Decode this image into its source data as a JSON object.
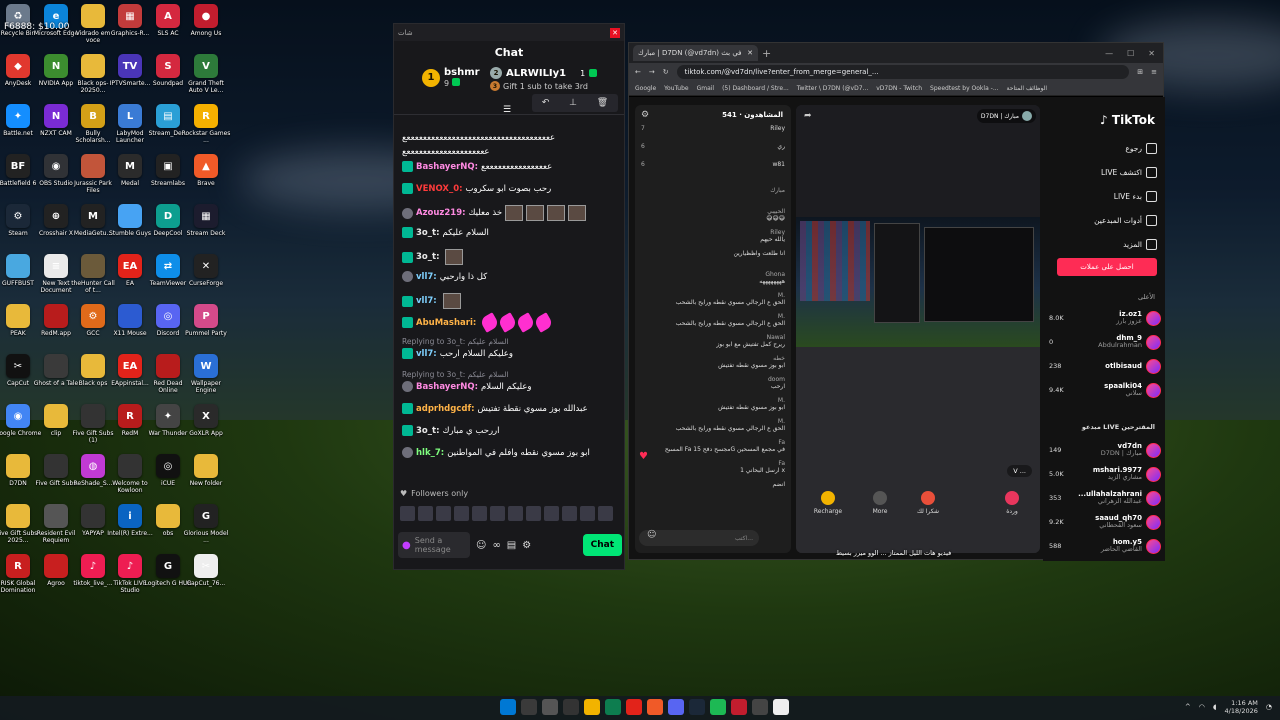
{
  "overlay": {
    "fps": "F6888: $10.00"
  },
  "desktop_icons": [
    {
      "label": "Recycle Bin",
      "color": "#6b7a8c",
      "glyph": "♻"
    },
    {
      "label": "Microsoft Edge",
      "color": "#0b84d9",
      "glyph": "e"
    },
    {
      "label": "Vidrado em voce",
      "color": "#e8b93a",
      "glyph": ""
    },
    {
      "label": "Graphics-R...",
      "color": "#c23b3b",
      "glyph": "▦"
    },
    {
      "label": "SLS AC",
      "color": "#d4283f",
      "glyph": "A"
    },
    {
      "label": "Among Us",
      "color": "#c21d2e",
      "glyph": "●"
    },
    {
      "label": "AnyDesk",
      "color": "#e1382e",
      "glyph": "◆"
    },
    {
      "label": "NVIDIA App",
      "color": "#3c8d2f",
      "glyph": "N"
    },
    {
      "label": "Black ops-20250...",
      "color": "#e8b93a",
      "glyph": ""
    },
    {
      "label": "IPTVSmarte...",
      "color": "#4a35b8",
      "glyph": "TV"
    },
    {
      "label": "Soundpad",
      "color": "#d4283f",
      "glyph": "S"
    },
    {
      "label": "Grand Theft Auto V Le...",
      "color": "#2d7a3a",
      "glyph": "V"
    },
    {
      "label": "Battle.net",
      "color": "#148eff",
      "glyph": "✦"
    },
    {
      "label": "NZXT CAM",
      "color": "#7a2bd4",
      "glyph": "N"
    },
    {
      "label": "Bully Scholarsh...",
      "color": "#d4a017",
      "glyph": "B"
    },
    {
      "label": "LabyMod Launcher",
      "color": "#3a7bd5",
      "glyph": "L"
    },
    {
      "label": "Stream_De...",
      "color": "#2a9fd6",
      "glyph": "▤"
    },
    {
      "label": "Rockstar Games ...",
      "color": "#f5b000",
      "glyph": "R"
    },
    {
      "label": "Battlefield 6",
      "color": "#222",
      "glyph": "BF"
    },
    {
      "label": "OBS Studio",
      "color": "#303236",
      "glyph": "◉"
    },
    {
      "label": "Jurassic Park Files",
      "color": "#c2553a",
      "glyph": ""
    },
    {
      "label": "Medal",
      "color": "#2b2b2b",
      "glyph": "M"
    },
    {
      "label": "Streamlabs",
      "color": "#222",
      "glyph": "▣"
    },
    {
      "label": "Brave",
      "color": "#f05a28",
      "glyph": "▲"
    },
    {
      "label": "Steam",
      "color": "#1b2838",
      "glyph": "⚙"
    },
    {
      "label": "Crosshair X",
      "color": "#222",
      "glyph": "⊕"
    },
    {
      "label": "MediaGetu...",
      "color": "#222",
      "glyph": "M"
    },
    {
      "label": "Stumble Guys",
      "color": "#47a3f3",
      "glyph": ""
    },
    {
      "label": "DeepCool",
      "color": "#0d9e8f",
      "glyph": "D"
    },
    {
      "label": "Stream Deck",
      "color": "#1c1c2e",
      "glyph": "▦"
    },
    {
      "label": "GUFFBUST",
      "color": "#49a8e0",
      "glyph": ""
    },
    {
      "label": "New Text Document",
      "color": "#eaeaea",
      "glyph": "≡"
    },
    {
      "label": "theHunter Call of t...",
      "color": "#6b5a3a",
      "glyph": ""
    },
    {
      "label": "EA",
      "color": "#e2231a",
      "glyph": "EA"
    },
    {
      "label": "TeamViewer",
      "color": "#0e8ee9",
      "glyph": "⇄"
    },
    {
      "label": "CurseForge",
      "color": "#222",
      "glyph": "✕"
    },
    {
      "label": "PEAK",
      "color": "#e8b93a",
      "glyph": ""
    },
    {
      "label": "RedM.app",
      "color": "#b81c1c",
      "glyph": ""
    },
    {
      "label": "GCC",
      "color": "#e06a1a",
      "glyph": "⚙"
    },
    {
      "label": "X11 Mouse",
      "color": "#2c5bd1",
      "glyph": ""
    },
    {
      "label": "Discord",
      "color": "#5865f2",
      "glyph": "◎"
    },
    {
      "label": "Pummel Party",
      "color": "#d44a8a",
      "glyph": "P"
    },
    {
      "label": "CapCut",
      "color": "#111",
      "glyph": "✂"
    },
    {
      "label": "Ghost of a Tale",
      "color": "#3a3a3a",
      "glyph": ""
    },
    {
      "label": "Black ops",
      "color": "#e8b93a",
      "glyph": ""
    },
    {
      "label": "EAppinstal...",
      "color": "#e2231a",
      "glyph": "EA"
    },
    {
      "label": "Red Dead Online",
      "color": "#b81c1c",
      "glyph": ""
    },
    {
      "label": "Wallpaper Engine",
      "color": "#2a6fd6",
      "glyph": "W"
    },
    {
      "label": "Google Chrome",
      "color": "#4285f4",
      "glyph": "◉"
    },
    {
      "label": "clip",
      "color": "#e8b93a",
      "glyph": ""
    },
    {
      "label": "Five Gift Subs (1)",
      "color": "#333",
      "glyph": ""
    },
    {
      "label": "RedM",
      "color": "#b81c1c",
      "glyph": "R"
    },
    {
      "label": "War Thunder",
      "color": "#444",
      "glyph": "✦"
    },
    {
      "label": "GoXLR App",
      "color": "#2a2a2a",
      "glyph": "X"
    },
    {
      "label": "D7DN",
      "color": "#e8b93a",
      "glyph": ""
    },
    {
      "label": "Five Gift Subs",
      "color": "#333",
      "glyph": ""
    },
    {
      "label": "ReShade_S...",
      "color": "#c03ad4",
      "glyph": "◍"
    },
    {
      "label": "Welcome to Kowloon",
      "color": "#333",
      "glyph": ""
    },
    {
      "label": "iCUE",
      "color": "#111",
      "glyph": "◎"
    },
    {
      "label": "New folder",
      "color": "#e8b93a",
      "glyph": ""
    },
    {
      "label": "Five Gift Subs-2025...",
      "color": "#e8b93a",
      "glyph": ""
    },
    {
      "label": "Resident Evil Requiem",
      "color": "#555",
      "glyph": ""
    },
    {
      "label": "YAPYAP",
      "color": "#333",
      "glyph": ""
    },
    {
      "label": "Intel(R) Extre...",
      "color": "#0a64c2",
      "glyph": "i"
    },
    {
      "label": "obs",
      "color": "#e8b93a",
      "glyph": ""
    },
    {
      "label": "Glorious Model ...",
      "color": "#222",
      "glyph": "G"
    },
    {
      "label": "RISK Global Domination",
      "color": "#c81f1f",
      "glyph": "R"
    },
    {
      "label": "Agroo",
      "color": "#c81f1f",
      "glyph": ""
    },
    {
      "label": "tiktok_live_...",
      "color": "#ee1d52",
      "glyph": "♪"
    },
    {
      "label": "TikTok LIVE Studio",
      "color": "#ee1d52",
      "glyph": "♪"
    },
    {
      "label": "Logitech G HUB",
      "color": "#111",
      "glyph": "G"
    },
    {
      "label": "CapCut_76...",
      "color": "#eee",
      "glyph": "✂"
    }
  ],
  "chat_window": {
    "bar_title": "شات",
    "title": "Chat",
    "leaders": [
      {
        "rank": "1",
        "name": "bshmr",
        "sub": "9"
      },
      {
        "name": "ALRWILIy1",
        "count": "1",
        "note": "Gift 1 sub to take 3rd"
      }
    ],
    "messages": [
      {
        "kind": "plain",
        "text": "ععععععععععععععععععععععععععععععععععععع"
      },
      {
        "kind": "plain",
        "text": "ععععععععععععععععععععع"
      },
      {
        "kind": "msg",
        "user": "BashayerNQ:",
        "text": "ععععععععععععععععع",
        "color": "#ff8ae2"
      },
      {
        "kind": "msg",
        "user": "VENOX_0:",
        "text": "رحب بصوت ابو سكروب",
        "color": "#ff3b3b"
      },
      {
        "kind": "msg",
        "user": "Azouz219:",
        "text": "خذ معليك",
        "color": "#ff8ae2"
      },
      {
        "kind": "msg",
        "user": "3o_t:",
        "text": "السلام عليكم",
        "color": "#e9e9e9"
      },
      {
        "kind": "msg",
        "user": "3o_t:",
        "text": "",
        "color": "#e9e9e9"
      },
      {
        "kind": "msg",
        "user": "vll7:",
        "text": "كل ذا وارحبي",
        "color": "#7fd1ff"
      },
      {
        "kind": "msg",
        "user": "vll7:",
        "text": "",
        "color": "#7fd1ff"
      },
      {
        "kind": "msg",
        "user": "AbuMashari:",
        "text": "",
        "color": "#ffb347"
      },
      {
        "kind": "reply",
        "text": "Replying to 3o_t: السلام عليكم"
      },
      {
        "kind": "msg",
        "user": "vll7:",
        "text": "وعليكم السلام ارحب",
        "color": "#7fd1ff"
      },
      {
        "kind": "reply",
        "text": "Replying to 3o_t: السلام عليكم"
      },
      {
        "kind": "msg",
        "user": "BashayerNQ:",
        "text": "وعليكم السلام",
        "color": "#ff8ae2"
      },
      {
        "kind": "msg",
        "user": "adprhdgcdf:",
        "text": "عبدالله بوز مسوي نقطة تفتيش",
        "color": "#ffb347"
      },
      {
        "kind": "msg",
        "user": "3o_t:",
        "text": "اررحب ي مبارك",
        "color": "#e9e9e9"
      },
      {
        "kind": "msg",
        "user": "hlk_7:",
        "text": "ابو بوز مسوي نقطه وافلم في المواطنين",
        "color": "#7fff7f"
      }
    ],
    "followers_label": "Followers only",
    "input_placeholder": "Send a message",
    "chat_button": "Chat"
  },
  "browser": {
    "tab_title": "مبارك | D7DN (@vd7dn) في بث",
    "url": "tiktok.com/@vd7dn/live?enter_from_merge=general_...",
    "bookmarks": [
      "Google",
      "YouTube",
      "Gmail",
      "(5) Dashboard / Stre...",
      "Twitter \\ D7DN (@vD7...",
      "vD7DN - Twitch",
      "Speedtest by Ookla -...",
      "الوظائف المتاحة"
    ]
  },
  "tiktok": {
    "logo": "TikTok",
    "viewers_header": "المشاهدون · 541",
    "top_viewers": [
      {
        "rank": "7",
        "name": "Riley"
      },
      {
        "rank": "6",
        "name": "ري"
      },
      {
        "rank": "6",
        "name": "w81"
      }
    ],
    "feed": [
      {
        "name": "مبارك",
        "text": ""
      },
      {
        "name": "الحبيبي",
        "text": "😅😅😅"
      },
      {
        "name": "Riley",
        "text": "يالله حيهم"
      },
      {
        "name": "",
        "text": "انا طلعت واظظيارين"
      },
      {
        "name": "Ghona",
        "text": "ههههههههه"
      },
      {
        "name": "M.",
        "text": "الحق ع الرجالي مسوي نقطه ورايح بالشحب"
      },
      {
        "name": "M.",
        "text": "الحق ع الرجالي مسوي نقطه ورايح بالشحب"
      },
      {
        "name": "Nawal",
        "text": "ريرح كمل تفتيش مع ابو بوز"
      },
      {
        "name": "خطه",
        "text": "ابو بوز مسوي نقطه تفتيش"
      },
      {
        "name": "doom",
        "text": "ارحب"
      },
      {
        "name": "M.",
        "text": "ابو بوز مسوي نقطه تفتيش"
      },
      {
        "name": "M.",
        "text": "الحق ع الرجالي مسوي نقطه ورايح بالشحب"
      },
      {
        "name": "Fa",
        "text": "المسبح Fa مجسح دفح 15G في مجمع المسحين"
      },
      {
        "name": "Fa",
        "text": "ارسل البحاني 1 x"
      },
      {
        "name": "",
        "text": "انضم"
      }
    ],
    "comment_placeholder": "اكتب...",
    "stream_title": "فيديو هات الليل الممتاز ... الوو ميرر بسيط",
    "streamer_chip": "D7DN | مبارك",
    "stream_badge": "V ...",
    "bottom_buttons": [
      "Recharge",
      "More",
      "شكرا لك",
      "وردة"
    ],
    "nav": [
      "رجوع",
      "LIVE اكتشف",
      "LIVE بدء",
      "أدوات المبدعين",
      "المزيد"
    ],
    "get_coins": "احصل على عملات",
    "top_header": "الأعلى",
    "top_list": [
      {
        "name": "iz.oz1",
        "sub": "عزوز بارز",
        "count": "8.0K"
      },
      {
        "name": "dhm_9",
        "sub": "Abdulrahman",
        "count": "0"
      },
      {
        "name": "otlbisaud",
        "sub": "",
        "count": "238"
      },
      {
        "name": "spaalki04",
        "sub": "سلاني",
        "count": "9.4K"
      }
    ],
    "recommended_header": "مبدعو LIVE المقترحين",
    "recommended": [
      {
        "name": "vd7dn",
        "sub": "D7DN | مبارك",
        "count": "149"
      },
      {
        "name": "mshari.9977",
        "sub": "مشاري الزيد",
        "count": "5.0K"
      },
      {
        "name": "...ullahalzahrani",
        "sub": "عبدالله الزهراني",
        "count": "353"
      },
      {
        "name": "saaud_qh70",
        "sub": "سعود القحطاني",
        "count": "9.2K"
      },
      {
        "name": "hom.y5",
        "sub": "القاضي الحاضر",
        "count": "588"
      }
    ]
  },
  "taskbar": {
    "time": "1:16 AM",
    "date": "4/18/2026"
  }
}
